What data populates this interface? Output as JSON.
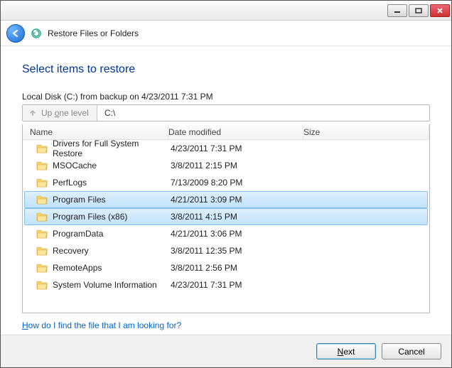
{
  "header": {
    "title": "Restore Files or Folders"
  },
  "page": {
    "title": "Select items to restore",
    "breadcrumb": "Local Disk (C:) from backup on 4/23/2011 7:31 PM"
  },
  "nav": {
    "up_label_pre": "Up ",
    "up_label_u": "o",
    "up_label_post": "ne level",
    "path": "C:\\"
  },
  "columns": {
    "name": "Name",
    "date": "Date modified",
    "size": "Size"
  },
  "rows": [
    {
      "name": "Drivers for Full System Restore",
      "date": "4/23/2011 7:31 PM",
      "size": "",
      "selected": false
    },
    {
      "name": "MSOCache",
      "date": "3/8/2011 2:15 PM",
      "size": "",
      "selected": false
    },
    {
      "name": "PerfLogs",
      "date": "7/13/2009 8:20 PM",
      "size": "",
      "selected": false
    },
    {
      "name": "Program Files",
      "date": "4/21/2011 3:09 PM",
      "size": "",
      "selected": true
    },
    {
      "name": "Program Files (x86)",
      "date": "3/8/2011 4:15 PM",
      "size": "",
      "selected": true
    },
    {
      "name": "ProgramData",
      "date": "4/21/2011 3:06 PM",
      "size": "",
      "selected": false
    },
    {
      "name": "Recovery",
      "date": "3/8/2011 12:35 PM",
      "size": "",
      "selected": false
    },
    {
      "name": "RemoteApps",
      "date": "3/8/2011 2:56 PM",
      "size": "",
      "selected": false
    },
    {
      "name": "System Volume Information",
      "date": "4/23/2011 7:31 PM",
      "size": "",
      "selected": false
    }
  ],
  "help": {
    "pre": "",
    "u": "H",
    "post": "ow do I find the file that I am looking for?"
  },
  "footer": {
    "next_u": "N",
    "next_post": "ext",
    "cancel": "Cancel"
  }
}
